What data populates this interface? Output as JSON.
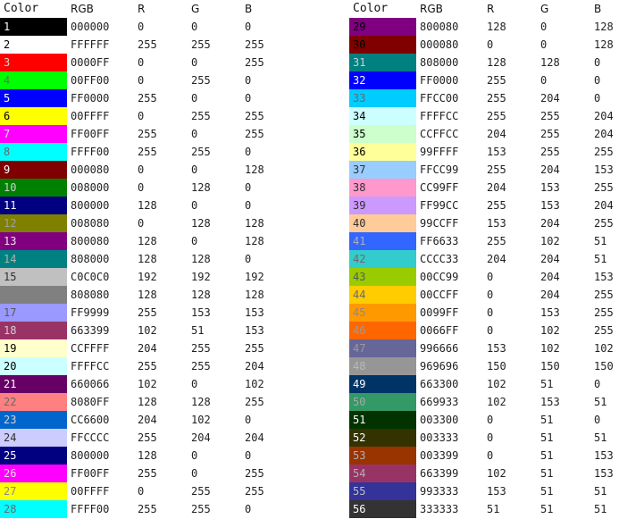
{
  "headers": {
    "color": "Color",
    "rgb": "RGB",
    "r": "R",
    "g": "G",
    "b": "B"
  },
  "left_rows": [
    {
      "num": "1",
      "bg": "#000000",
      "fg": "#ffffff",
      "rgb": "000000",
      "r": "0",
      "g": "0",
      "b": "0"
    },
    {
      "num": "2",
      "bg": "#ffffff",
      "fg": "#000000",
      "rgb": "FFFFFF",
      "r": "255",
      "g": "255",
      "b": "255"
    },
    {
      "num": "3",
      "bg": "#ff0000",
      "fg": "#d4d4d4",
      "rgb": "0000FF",
      "r": "0",
      "g": "0",
      "b": "255"
    },
    {
      "num": "4",
      "bg": "#00ff00",
      "fg": "#6a6a6a",
      "rgb": "00FF00",
      "r": "0",
      "g": "255",
      "b": "0"
    },
    {
      "num": "5",
      "bg": "#0000ff",
      "fg": "#ffffff",
      "rgb": "FF0000",
      "r": "255",
      "g": "0",
      "b": "0"
    },
    {
      "num": "6",
      "bg": "#ffff00",
      "fg": "#000000",
      "rgb": "00FFFF",
      "r": "0",
      "g": "255",
      "b": "255"
    },
    {
      "num": "7",
      "bg": "#ff00ff",
      "fg": "#e0e0e0",
      "rgb": "FF00FF",
      "r": "255",
      "g": "0",
      "b": "255"
    },
    {
      "num": "8",
      "bg": "#00ffff",
      "fg": "#6a6a6a",
      "rgb": "FFFF00",
      "r": "255",
      "g": "255",
      "b": "0"
    },
    {
      "num": "9",
      "bg": "#800000",
      "fg": "#ffffff",
      "rgb": "000080",
      "r": "0",
      "g": "0",
      "b": "128"
    },
    {
      "num": "10",
      "bg": "#008000",
      "fg": "#cfcfcf",
      "rgb": "008000",
      "r": "0",
      "g": "128",
      "b": "0"
    },
    {
      "num": "11",
      "bg": "#000080",
      "fg": "#ffffff",
      "rgb": "800000",
      "r": "128",
      "g": "0",
      "b": "0"
    },
    {
      "num": "12",
      "bg": "#808000",
      "fg": "#a0a0a0",
      "rgb": "008080",
      "r": "0",
      "g": "128",
      "b": "128"
    },
    {
      "num": "13",
      "bg": "#800080",
      "fg": "#e6e6e6",
      "rgb": "800080",
      "r": "128",
      "g": "0",
      "b": "128"
    },
    {
      "num": "14",
      "bg": "#008080",
      "fg": "#b0b0b0",
      "rgb": "808000",
      "r": "128",
      "g": "128",
      "b": "0"
    },
    {
      "num": "15",
      "bg": "#c0c0c0",
      "fg": "#303030",
      "rgb": "C0C0C0",
      "r": "192",
      "g": "192",
      "b": "192"
    },
    {
      "num": "",
      "bg": "#808080",
      "fg": "#ffffff",
      "rgb": "808080",
      "r": "128",
      "g": "128",
      "b": "128"
    },
    {
      "num": "17",
      "bg": "#9999ff",
      "fg": "#5a5a5a",
      "rgb": "FF9999",
      "r": "255",
      "g": "153",
      "b": "153"
    },
    {
      "num": "18",
      "bg": "#993366",
      "fg": "#d0d0d0",
      "rgb": "663399",
      "r": "102",
      "g": "51",
      "b": "153"
    },
    {
      "num": "19",
      "bg": "#ffffcc",
      "fg": "#000000",
      "rgb": "CCFFFF",
      "r": "204",
      "g": "255",
      "b": "255"
    },
    {
      "num": "20",
      "bg": "#ccffff",
      "fg": "#000000",
      "rgb": "FFFFCC",
      "r": "255",
      "g": "255",
      "b": "204"
    },
    {
      "num": "21",
      "bg": "#660066",
      "fg": "#ffffff",
      "rgb": "660066",
      "r": "102",
      "g": "0",
      "b": "102"
    },
    {
      "num": "22",
      "bg": "#ff8080",
      "fg": "#6a6a6a",
      "rgb": "8080FF",
      "r": "128",
      "g": "128",
      "b": "255"
    },
    {
      "num": "23",
      "bg": "#0066cc",
      "fg": "#d0d0d0",
      "rgb": "CC6600",
      "r": "204",
      "g": "102",
      "b": "0"
    },
    {
      "num": "24",
      "bg": "#ccccff",
      "fg": "#303030",
      "rgb": "FFCCCC",
      "r": "255",
      "g": "204",
      "b": "204"
    },
    {
      "num": "25",
      "bg": "#000080",
      "fg": "#ffffff",
      "rgb": "800000",
      "r": "128",
      "g": "0",
      "b": "0"
    },
    {
      "num": "26",
      "bg": "#ff00ff",
      "fg": "#e0e0e0",
      "rgb": "FF00FF",
      "r": "255",
      "g": "0",
      "b": "255"
    },
    {
      "num": "27",
      "bg": "#ffff00",
      "fg": "#8a8a8a",
      "rgb": "00FFFF",
      "r": "0",
      "g": "255",
      "b": "255"
    },
    {
      "num": "28",
      "bg": "#00ffff",
      "fg": "#6a6a6a",
      "rgb": "FFFF00",
      "r": "255",
      "g": "255",
      "b": "0"
    }
  ],
  "right_rows": [
    {
      "num": "29",
      "bg": "#800080",
      "fg": "#000000",
      "rgb": "800080",
      "r": "128",
      "g": "0",
      "b": "128"
    },
    {
      "num": "30",
      "bg": "#800000",
      "fg": "#000000",
      "rgb": "000080",
      "r": "0",
      "g": "0",
      "b": "128"
    },
    {
      "num": "31",
      "bg": "#008080",
      "fg": "#d0d0d0",
      "rgb": "808000",
      "r": "128",
      "g": "128",
      "b": "0"
    },
    {
      "num": "32",
      "bg": "#0000ff",
      "fg": "#ffffff",
      "rgb": "FF0000",
      "r": "255",
      "g": "0",
      "b": "0"
    },
    {
      "num": "33",
      "bg": "#00ccff",
      "fg": "#6a6a6a",
      "rgb": "FFCC00",
      "r": "255",
      "g": "204",
      "b": "0"
    },
    {
      "num": "34",
      "bg": "#ccffff",
      "fg": "#000000",
      "rgb": "FFFFCC",
      "r": "255",
      "g": "255",
      "b": "204"
    },
    {
      "num": "35",
      "bg": "#ccffcc",
      "fg": "#000000",
      "rgb": "CCFFCC",
      "r": "204",
      "g": "255",
      "b": "204"
    },
    {
      "num": "36",
      "bg": "#ffff99",
      "fg": "#000000",
      "rgb": "99FFFF",
      "r": "153",
      "g": "255",
      "b": "255"
    },
    {
      "num": "37",
      "bg": "#99ccff",
      "fg": "#303030",
      "rgb": "FFCC99",
      "r": "255",
      "g": "204",
      "b": "153"
    },
    {
      "num": "38",
      "bg": "#ff99cc",
      "fg": "#303030",
      "rgb": "CC99FF",
      "r": "204",
      "g": "153",
      "b": "255"
    },
    {
      "num": "39",
      "bg": "#cc99ff",
      "fg": "#303030",
      "rgb": "FF99CC",
      "r": "255",
      "g": "153",
      "b": "204"
    },
    {
      "num": "40",
      "bg": "#ffcc99",
      "fg": "#303030",
      "rgb": "99CCFF",
      "r": "153",
      "g": "204",
      "b": "255"
    },
    {
      "num": "41",
      "bg": "#3366ff",
      "fg": "#b0b0b0",
      "rgb": "FF6633",
      "r": "255",
      "g": "102",
      "b": "51"
    },
    {
      "num": "42",
      "bg": "#33cccc",
      "fg": "#6a6a6a",
      "rgb": "CCCC33",
      "r": "204",
      "g": "204",
      "b": "51"
    },
    {
      "num": "43",
      "bg": "#99cc00",
      "fg": "#5a5a5a",
      "rgb": "00CC99",
      "r": "0",
      "g": "204",
      "b": "153"
    },
    {
      "num": "44",
      "bg": "#ffcc00",
      "fg": "#6a6a6a",
      "rgb": "00CCFF",
      "r": "0",
      "g": "204",
      "b": "255"
    },
    {
      "num": "45",
      "bg": "#ff9900",
      "fg": "#8a8a8a",
      "rgb": "0099FF",
      "r": "0",
      "g": "153",
      "b": "255"
    },
    {
      "num": "46",
      "bg": "#ff6600",
      "fg": "#9a9a9a",
      "rgb": "0066FF",
      "r": "0",
      "g": "102",
      "b": "255"
    },
    {
      "num": "47",
      "bg": "#666699",
      "fg": "#9a9a9a",
      "rgb": "996666",
      "r": "153",
      "g": "102",
      "b": "102"
    },
    {
      "num": "48",
      "bg": "#969696",
      "fg": "#b8b8b8",
      "rgb": "969696",
      "r": "150",
      "g": "150",
      "b": "150"
    },
    {
      "num": "49",
      "bg": "#003366",
      "fg": "#ffffff",
      "rgb": "663300",
      "r": "102",
      "g": "51",
      "b": "0"
    },
    {
      "num": "50",
      "bg": "#339966",
      "fg": "#a8a8a8",
      "rgb": "669933",
      "r": "102",
      "g": "153",
      "b": "51"
    },
    {
      "num": "51",
      "bg": "#003300",
      "fg": "#ffffff",
      "rgb": "003300",
      "r": "0",
      "g": "51",
      "b": "0"
    },
    {
      "num": "52",
      "bg": "#333300",
      "fg": "#ffffff",
      "rgb": "003333",
      "r": "0",
      "g": "51",
      "b": "51"
    },
    {
      "num": "53",
      "bg": "#993300",
      "fg": "#b0b0b0",
      "rgb": "003399",
      "r": "0",
      "g": "51",
      "b": "153"
    },
    {
      "num": "54",
      "bg": "#993366",
      "fg": "#b0b0b0",
      "rgb": "663399",
      "r": "102",
      "g": "51",
      "b": "153"
    },
    {
      "num": "55",
      "bg": "#333399",
      "fg": "#c0c0c0",
      "rgb": "993333",
      "r": "153",
      "g": "51",
      "b": "51"
    },
    {
      "num": "56",
      "bg": "#333333",
      "fg": "#ffffff",
      "rgb": "333333",
      "r": "51",
      "g": "51",
      "b": "51"
    }
  ]
}
